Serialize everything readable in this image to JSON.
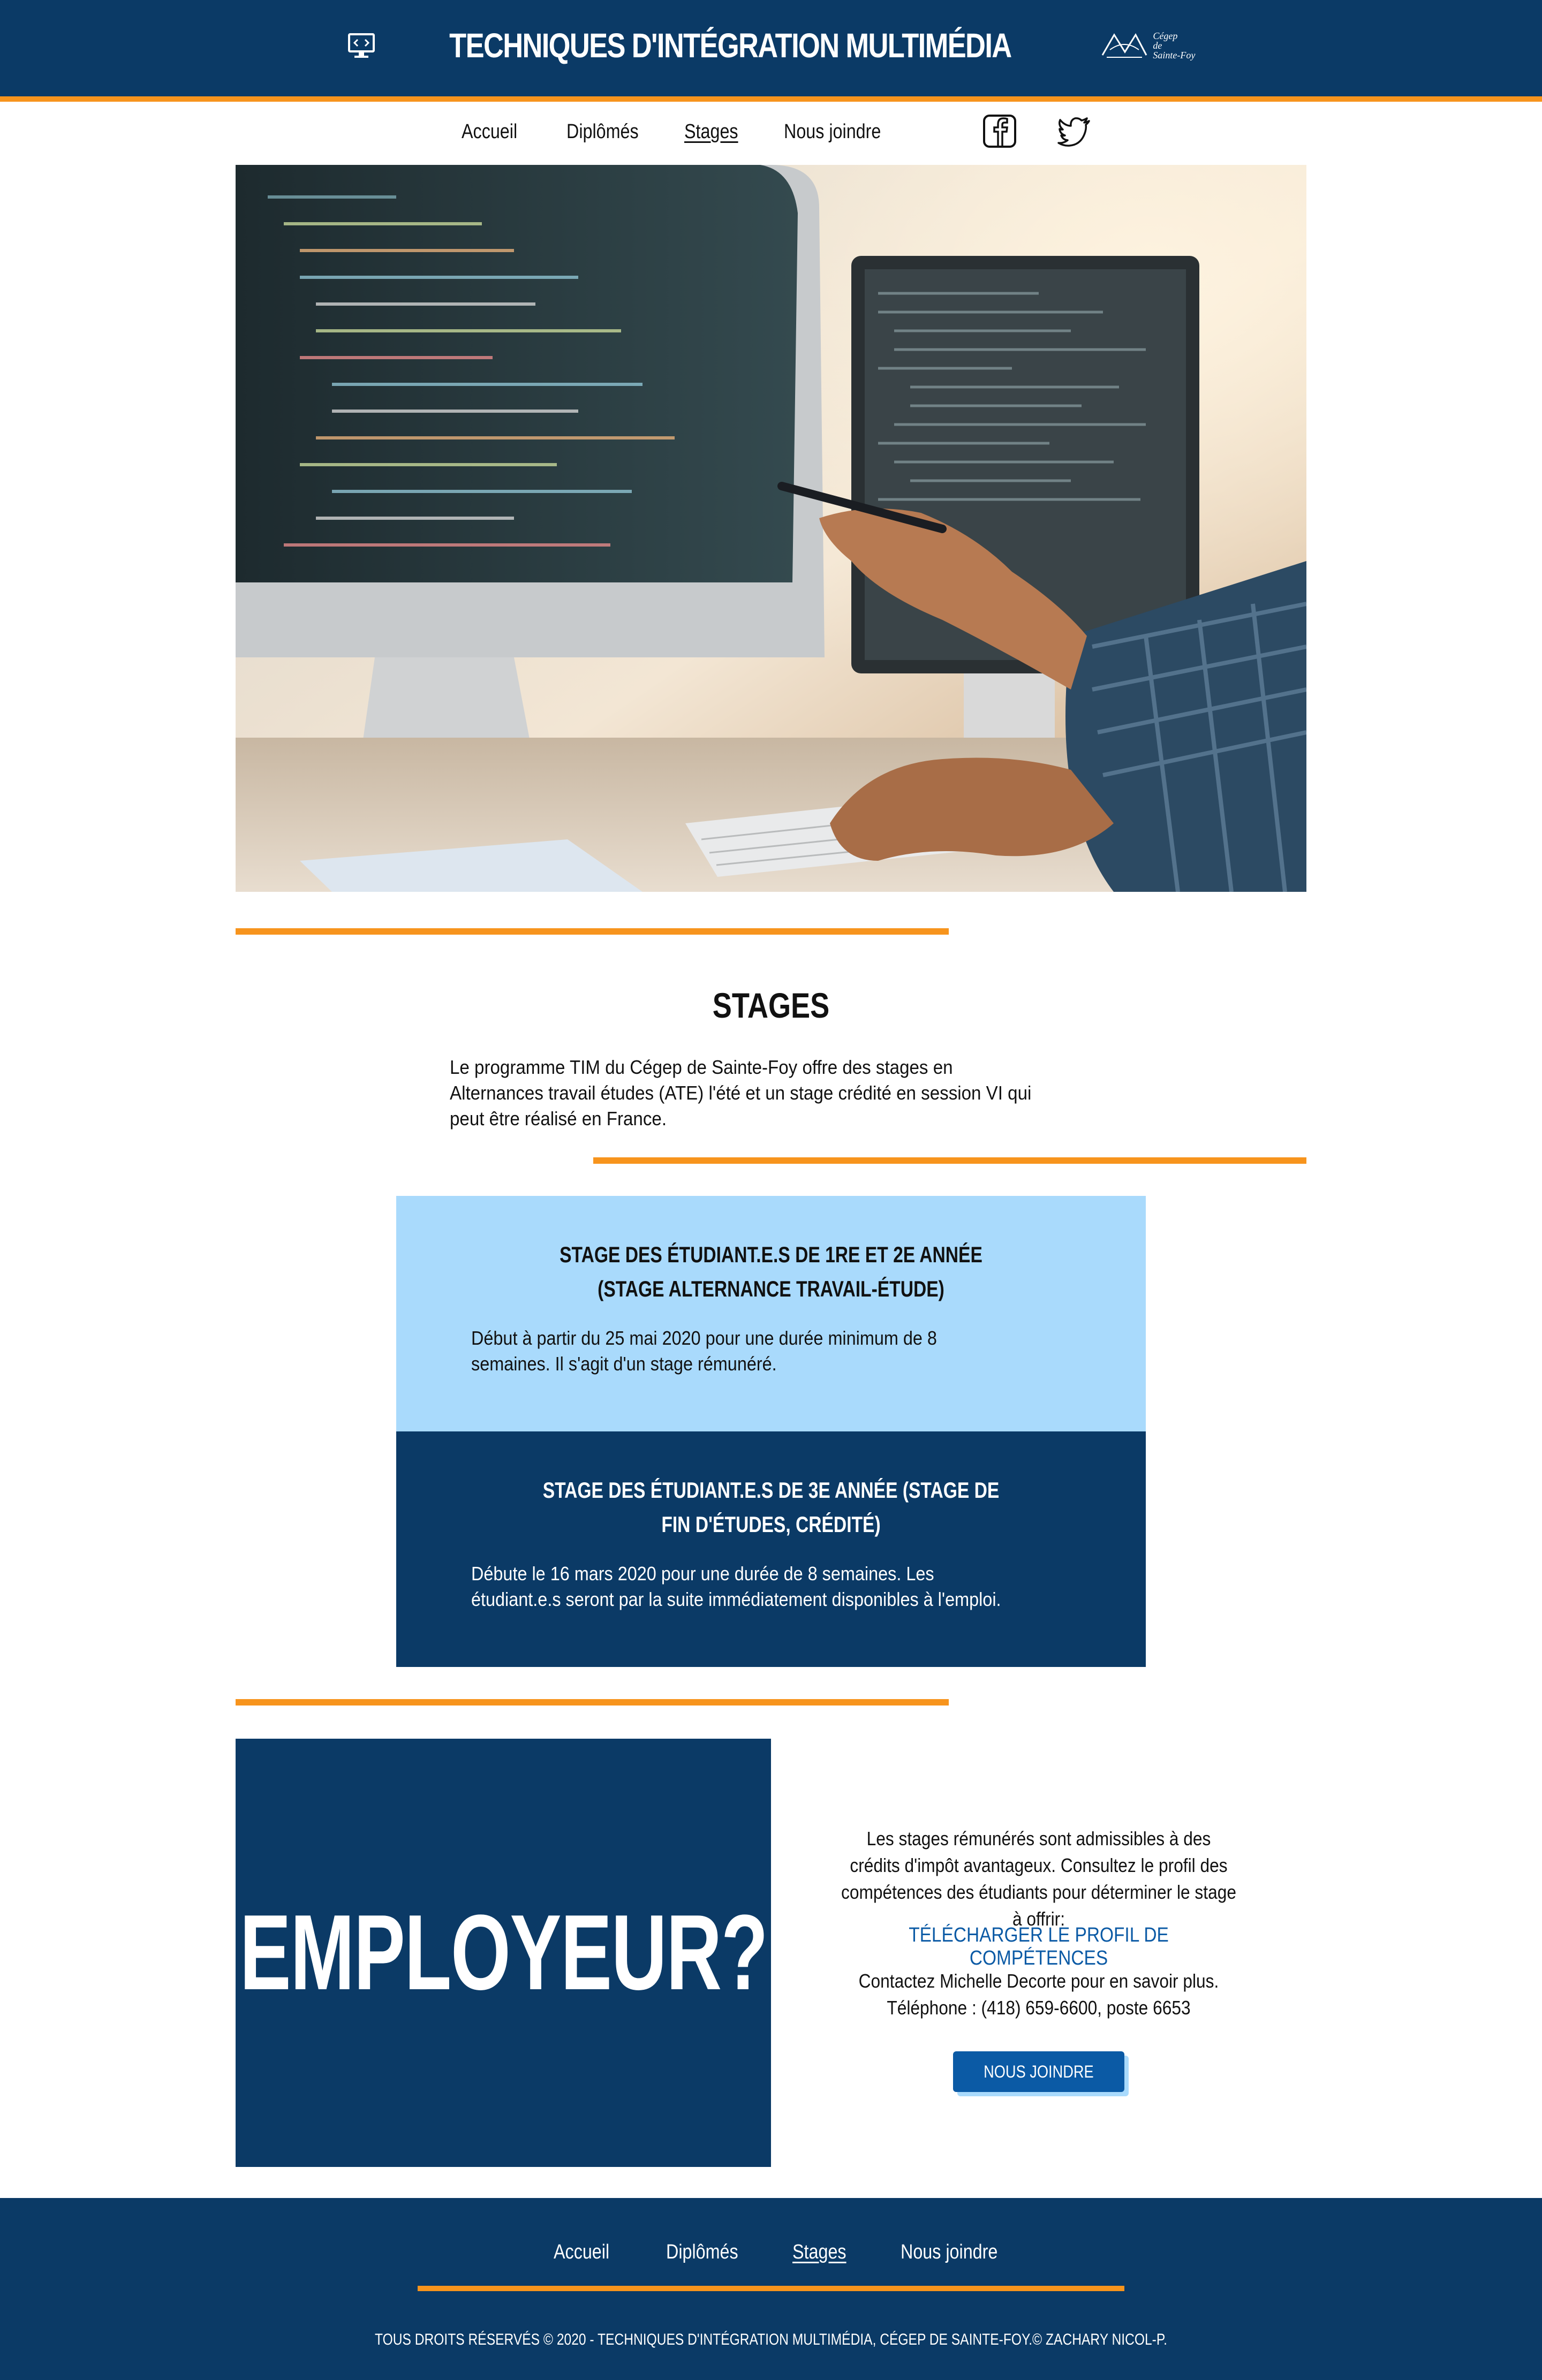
{
  "header": {
    "title": "TECHNIQUES D'INTÉGRATION MULTIMÉDIA",
    "logo_icon": "monitor-code-icon",
    "cegep_logo": {
      "line1": "Cégep",
      "line2": "de",
      "line3": "Sainte-Foy",
      "icon": "open-book-icon"
    }
  },
  "nav": {
    "items": [
      {
        "label": "Accueil",
        "active": false
      },
      {
        "label": "Diplômés",
        "active": false
      },
      {
        "label": "Stages",
        "active": true
      },
      {
        "label": "Nous joindre",
        "active": false
      }
    ],
    "social": [
      "facebook-icon",
      "twitter-icon"
    ]
  },
  "hero": {
    "image": "developer pointing pen at code on dual monitors"
  },
  "stages": {
    "title": "STAGES",
    "intro": "Le programme TIM du Cégep de Sainte-Foy offre des stages en Alternances travail études (ATE) l'été et un stage crédité en session VI qui peut être réalisé en France."
  },
  "cards": [
    {
      "title": "STAGE DES ÉTUDIANT.E.S DE 1RE ET 2E ANNÉE (STAGE ALTERNANCE TRAVAIL-ÉTUDE)",
      "text": "Début à partir du 25 mai 2020 pour une durée minimum de 8 semaines. Il s'agit d'un stage rémunéré."
    },
    {
      "title": "STAGE DES ÉTUDIANT.E.S DE 3E ANNÉE (STAGE DE FIN D'ÉTUDES, CRÉDITÉ)",
      "text": "Débute le 16 mars 2020 pour une durée de 8 semaines. Les étudiant.e.s seront par la suite immédiatement disponibles à l'emploi."
    }
  ],
  "employer": {
    "title": "EMPLOYEUR?",
    "info": "Les stages rémunérés sont admissibles à des crédits d'impôt avantageux. Consultez le profil des compétences des étudiants pour déterminer le stage à offrir:",
    "download_link": "TÉLÉCHARGER LE PROFIL DE COMPÉTENCES",
    "contact_line1": "Contactez Michelle Decorte pour en savoir plus.",
    "contact_line2": "Téléphone : (418) 659-6600, poste 6653",
    "button": "NOUS JOINDRE"
  },
  "footer": {
    "items": [
      {
        "label": "Accueil",
        "active": false
      },
      {
        "label": "Diplômés",
        "active": false
      },
      {
        "label": "Stages",
        "active": true
      },
      {
        "label": "Nous joindre",
        "active": false
      }
    ],
    "copyright": "TOUS DROITS RÉSERVÉS © 2020 - TECHNIQUES D'INTÉGRATION MULTIMÉDIA, CÉGEP DE SAINTE-FOY.© ZACHARY NICOL-P."
  },
  "colors": {
    "primary_dark": "#0b3a66",
    "accent_orange": "#f7941d",
    "light_blue": "#a9dafc",
    "link_blue": "#0b5aa5"
  }
}
